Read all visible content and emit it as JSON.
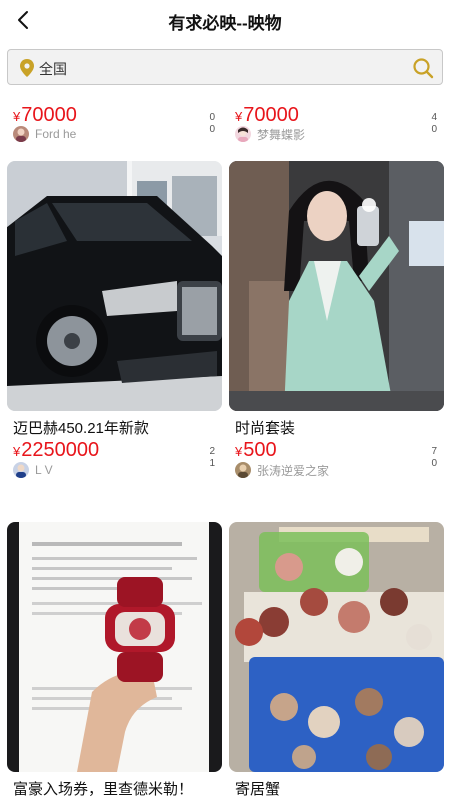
{
  "header": {
    "title": "有求必映--映物",
    "back_icon": "chevron-left-icon"
  },
  "search": {
    "location": "全国",
    "location_icon": "location-pin-icon",
    "search_icon": "search-icon",
    "accent_color": "#c9a227"
  },
  "colors": {
    "price": "#e8151b",
    "seller_name": "#9a9a9a"
  },
  "listings": [
    {
      "title": "",
      "currency": "¥",
      "price": "70000",
      "stat_top": "0",
      "stat_bottom": "0",
      "seller": "Ford he"
    },
    {
      "title": "",
      "currency": "¥",
      "price": "70000",
      "stat_top": "4",
      "stat_bottom": "0",
      "seller": "梦舞蝶影"
    },
    {
      "title": "迈巴赫450.21年新款",
      "currency": "¥",
      "price": "2250000",
      "stat_top": "2",
      "stat_bottom": "1",
      "seller": "L V"
    },
    {
      "title": "时尚套装",
      "currency": "¥",
      "price": "500",
      "stat_top": "7",
      "stat_bottom": "0",
      "seller": "张涛逆爱之家"
    },
    {
      "title": "富豪入场券，里查德米勒！",
      "currency": "",
      "price": "",
      "stat_top": "",
      "stat_bottom": "",
      "seller": ""
    },
    {
      "title": "寄居蟹",
      "currency": "",
      "price": "",
      "stat_top": "",
      "stat_bottom": "",
      "seller": ""
    }
  ]
}
